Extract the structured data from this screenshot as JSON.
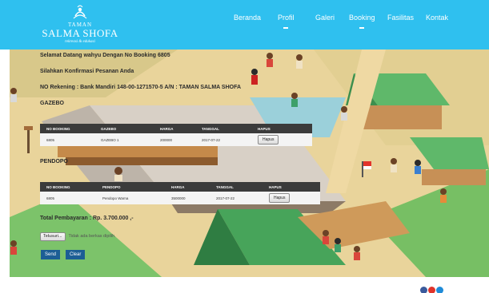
{
  "header": {
    "logo": {
      "line_small": "TAMAN",
      "line_big": "SALMA SHOFA",
      "tagline": "rekreasi & edukasi"
    },
    "nav": [
      {
        "label": "Beranda"
      },
      {
        "label": "Profil"
      },
      {
        "label": "Galeri"
      },
      {
        "label": "Booking"
      },
      {
        "label": "Fasilitas"
      },
      {
        "label": "Kontak"
      }
    ]
  },
  "content": {
    "welcome": "Selamat Datang wahyu Dengan No Booking 6805",
    "confirm": "Silahkan Konfirmasi Pesanan Anda",
    "rekening": "NO Rekening : Bank Mandiri 148-00-1271570-5 A/N : TAMAN SALMA SHOFA",
    "gazebo": {
      "title": "GAZEBO",
      "headers": [
        "NO BOOKING",
        "GAZEBO",
        "HARGA",
        "TANGGAL",
        "HAPUS"
      ],
      "rows": [
        {
          "no": "6805",
          "item": "GAZEBO 1",
          "harga": "200000",
          "tanggal": "2017-07-22",
          "hapus": "Hapus"
        }
      ]
    },
    "pendopo": {
      "title": "PENDOPO",
      "headers": [
        "NO BOOKING",
        "PENDOPO",
        "HARGA",
        "TANGGAL",
        "HAPUS"
      ],
      "rows": [
        {
          "no": "6805",
          "item": "Pendopo Warna",
          "harga": "3500000",
          "tanggal": "2017-07-22",
          "hapus": "Hapus"
        }
      ]
    },
    "total": "Total Pembayaran : Rp. 3.700.000 ,-",
    "file": {
      "button": "Telusuri...",
      "label": "Tidak ada berkas dipilih."
    },
    "send": "Send",
    "clear": "Clear"
  },
  "colors": {
    "header": "#2fc0ef",
    "table_header": "#3b3b3b",
    "button": "#1c5e95",
    "footer_dots": [
      "#3a5a9c",
      "#e0342b",
      "#1f8bd8"
    ]
  }
}
